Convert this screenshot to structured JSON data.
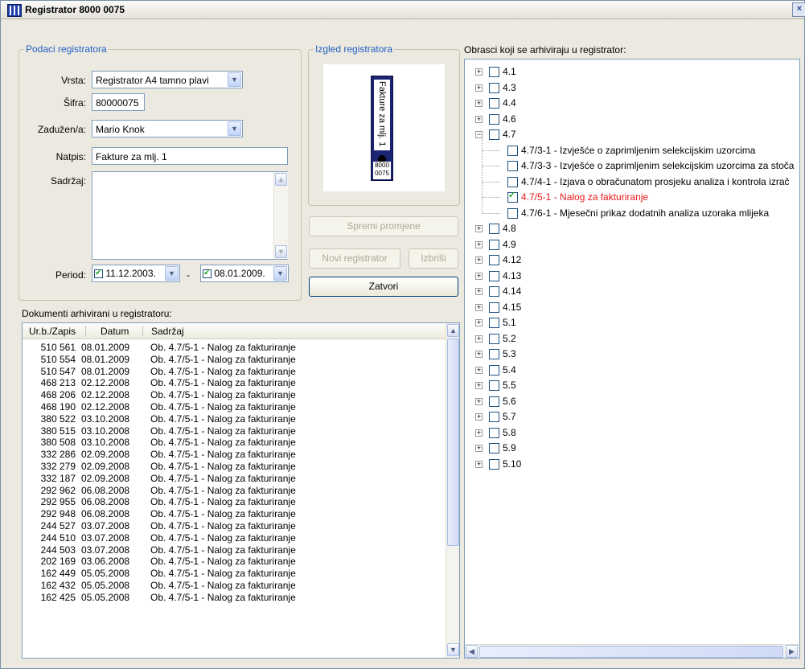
{
  "window": {
    "title": "Registrator 8000 0075",
    "close": "×"
  },
  "podaci": {
    "legend": "Podaci registratora",
    "vrsta_label": "Vrsta:",
    "vrsta_value": "Registrator A4 tamno plavi",
    "sifra_label": "Šifra:",
    "sifra_value": "80000075",
    "zaduzen_label": "Zadužen/a:",
    "zaduzen_value": "Mario Knok",
    "natpis_label": "Natpis:",
    "natpis_value": "Fakture za mlj. 1",
    "sadrzaj_label": "Sadržaj:",
    "sadrzaj_value": "",
    "period_label": "Period:",
    "period_from": "11.12.2003.",
    "period_sep": "-",
    "period_to": "08.01.2009."
  },
  "izgled": {
    "legend": "Izgled registratora",
    "spine_text": "Fakture za mlj. 1",
    "spine_code_1": "8000",
    "spine_code_2": "0075",
    "binder_color": "#1a2470"
  },
  "buttons": {
    "spremi": "Spremi promjene",
    "novi": "Novi registrator",
    "izbrisi": "Izbriši",
    "zatvori": "Zatvori"
  },
  "dokumenti": {
    "title": "Dokumenti arhivirani u registratoru:",
    "columns": [
      "Ur.b./Zapis",
      "Datum",
      "Sadržaj"
    ],
    "rows": [
      [
        "510 561",
        "08.01.2009",
        "Ob. 4.7/5-1 - Nalog za fakturiranje"
      ],
      [
        "510 554",
        "08.01.2009",
        "Ob. 4.7/5-1 - Nalog za fakturiranje"
      ],
      [
        "510 547",
        "08.01.2009",
        "Ob. 4.7/5-1 - Nalog za fakturiranje"
      ],
      [
        "468 213",
        "02.12.2008",
        "Ob. 4.7/5-1 - Nalog za fakturiranje"
      ],
      [
        "468 206",
        "02.12.2008",
        "Ob. 4.7/5-1 - Nalog za fakturiranje"
      ],
      [
        "468 190",
        "02.12.2008",
        "Ob. 4.7/5-1 - Nalog za fakturiranje"
      ],
      [
        "380 522",
        "03.10.2008",
        "Ob. 4.7/5-1 - Nalog za fakturiranje"
      ],
      [
        "380 515",
        "03.10.2008",
        "Ob. 4.7/5-1 - Nalog za fakturiranje"
      ],
      [
        "380 508",
        "03.10.2008",
        "Ob. 4.7/5-1 - Nalog za fakturiranje"
      ],
      [
        "332 286",
        "02.09.2008",
        "Ob. 4.7/5-1 - Nalog za fakturiranje"
      ],
      [
        "332 279",
        "02.09.2008",
        "Ob. 4.7/5-1 - Nalog za fakturiranje"
      ],
      [
        "332 187",
        "02.09.2008",
        "Ob. 4.7/5-1 - Nalog za fakturiranje"
      ],
      [
        "292 962",
        "06.08.2008",
        "Ob. 4.7/5-1 - Nalog za fakturiranje"
      ],
      [
        "292 955",
        "06.08.2008",
        "Ob. 4.7/5-1 - Nalog za fakturiranje"
      ],
      [
        "292 948",
        "06.08.2008",
        "Ob. 4.7/5-1 - Nalog za fakturiranje"
      ],
      [
        "244 527",
        "03.07.2008",
        "Ob. 4.7/5-1 - Nalog za fakturiranje"
      ],
      [
        "244 510",
        "03.07.2008",
        "Ob. 4.7/5-1 - Nalog za fakturiranje"
      ],
      [
        "244 503",
        "03.07.2008",
        "Ob. 4.7/5-1 - Nalog za fakturiranje"
      ],
      [
        "202 169",
        "03.06.2008",
        "Ob. 4.7/5-1 - Nalog za fakturiranje"
      ],
      [
        "162 449",
        "05.05.2008",
        "Ob. 4.7/5-1 - Nalog za fakturiranje"
      ],
      [
        "162 432",
        "05.05.2008",
        "Ob. 4.7/5-1 - Nalog za fakturiranje"
      ],
      [
        "162 425",
        "05.05.2008",
        "Ob. 4.7/5-1 - Nalog za fakturiranje"
      ]
    ]
  },
  "obrasci": {
    "title": "Obrasci koji se arhiviraju u registrator:",
    "nodes": [
      {
        "label": "4.1",
        "level": 0,
        "expanded": false,
        "checked": false
      },
      {
        "label": "4.3",
        "level": 0,
        "expanded": false,
        "checked": false
      },
      {
        "label": "4.4",
        "level": 0,
        "expanded": false,
        "checked": false
      },
      {
        "label": "4.6",
        "level": 0,
        "expanded": false,
        "checked": false
      },
      {
        "label": "4.7",
        "level": 0,
        "expanded": true,
        "checked": false
      },
      {
        "label": "4.7/3-1 - Izvješće o zaprimljenim selekcijskim uzorcima",
        "level": 1,
        "checked": false
      },
      {
        "label": "4.7/3-3 - Izvješće o zaprimljenim selekcijskim uzorcima za stoča",
        "level": 1,
        "checked": false
      },
      {
        "label": "4.7/4-1 - Izjava o obračunatom prosjeku analiza i kontrola izrač",
        "level": 1,
        "checked": false
      },
      {
        "label": "4.7/5-1 - Nalog za fakturiranje",
        "level": 1,
        "checked": true,
        "highlight": true
      },
      {
        "label": "4.7/6-1 - Mjesečni prikaz dodatnih analiza uzoraka mlijeka",
        "level": 1,
        "checked": false
      },
      {
        "label": "4.8",
        "level": 0,
        "expanded": false,
        "checked": false
      },
      {
        "label": "4.9",
        "level": 0,
        "expanded": false,
        "checked": false
      },
      {
        "label": "4.12",
        "level": 0,
        "expanded": false,
        "checked": false
      },
      {
        "label": "4.13",
        "level": 0,
        "expanded": false,
        "checked": false
      },
      {
        "label": "4.14",
        "level": 0,
        "expanded": false,
        "checked": false
      },
      {
        "label": "4.15",
        "level": 0,
        "expanded": false,
        "checked": false
      },
      {
        "label": "5.1",
        "level": 0,
        "expanded": false,
        "checked": false
      },
      {
        "label": "5.2",
        "level": 0,
        "expanded": false,
        "checked": false
      },
      {
        "label": "5.3",
        "level": 0,
        "expanded": false,
        "checked": false
      },
      {
        "label": "5.4",
        "level": 0,
        "expanded": false,
        "checked": false
      },
      {
        "label": "5.5",
        "level": 0,
        "expanded": false,
        "checked": false
      },
      {
        "label": "5.6",
        "level": 0,
        "expanded": false,
        "checked": false
      },
      {
        "label": "5.7",
        "level": 0,
        "expanded": false,
        "checked": false
      },
      {
        "label": "5.8",
        "level": 0,
        "expanded": false,
        "checked": false
      },
      {
        "label": "5.9",
        "level": 0,
        "expanded": false,
        "checked": false
      },
      {
        "label": "5.10",
        "level": 0,
        "expanded": false,
        "checked": false
      }
    ]
  },
  "colors": {
    "legend": "#1f5fc4",
    "highlight": "#e8181c"
  }
}
